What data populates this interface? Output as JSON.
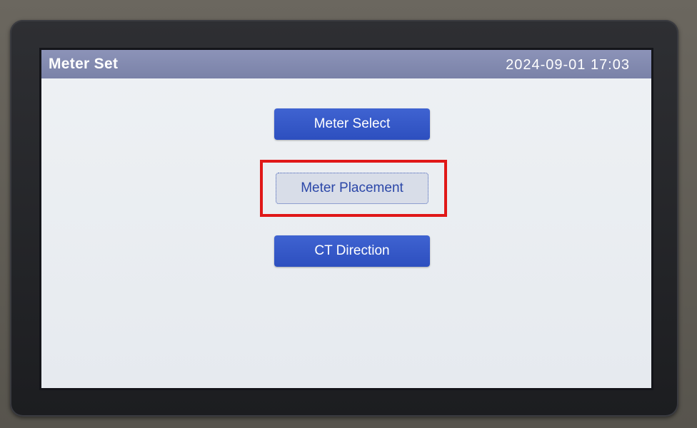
{
  "header": {
    "title": "Meter Set",
    "datetime": "2024-09-01  17:03"
  },
  "menu": {
    "items": [
      {
        "label": "Meter Select",
        "selected": false
      },
      {
        "label": "Meter Placement",
        "selected": true
      },
      {
        "label": "CT Direction",
        "selected": false
      }
    ]
  },
  "colors": {
    "titlebar": "#7f87ac",
    "button_blue": "#3558c7",
    "button_selected_bg": "#d8dde8",
    "highlight_annotation": "#e01818"
  }
}
